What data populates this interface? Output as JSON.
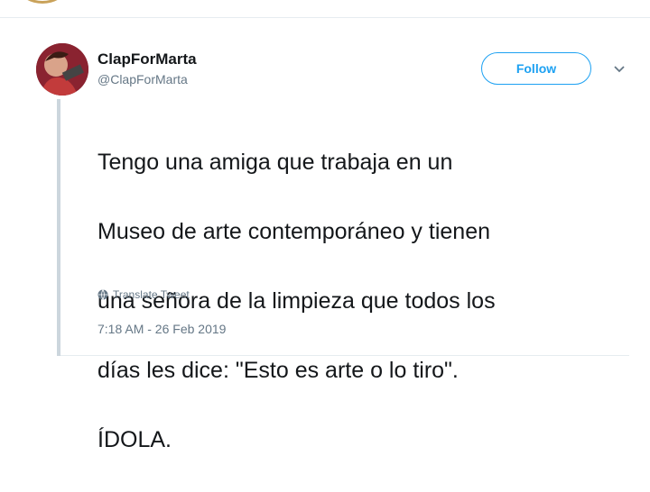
{
  "user": {
    "display_name": "ClapForMarta",
    "handle": "@ClapForMarta"
  },
  "actions": {
    "follow_label": "Follow"
  },
  "tweet": {
    "text_lines": [
      "Tengo una amiga que trabaja en un",
      "Museo de arte contemporáneo y tienen",
      "una señora de la limpieza que todos los",
      "días les dice: \"Esto es arte o lo tiro\".",
      "ÍDOLA."
    ],
    "translate_label": "Translate Tweet",
    "timestamp": "7:18 AM - 26 Feb 2019"
  },
  "colors": {
    "accent": "#1da1f2",
    "text": "#14171a",
    "muted": "#657786"
  },
  "icons": {
    "translate": "globe-icon",
    "more": "chevron-down-icon"
  }
}
